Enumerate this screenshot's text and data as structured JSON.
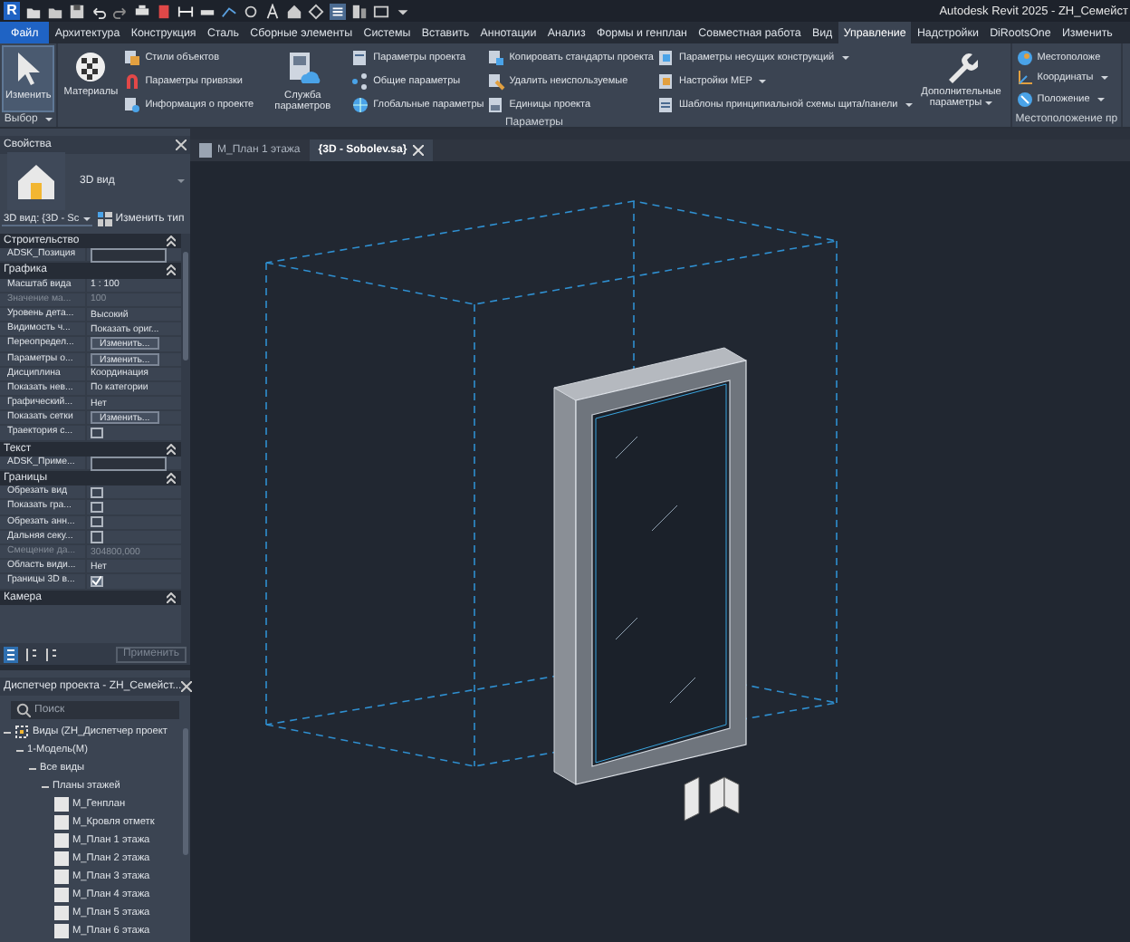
{
  "title_bar": {
    "logo": "R",
    "title": "Autodesk Revit 2025 - ZH_Семейст"
  },
  "menu_tabs": [
    {
      "label": "Файл",
      "kind": "file",
      "selected": false
    },
    {
      "label": "Архитектура",
      "kind": "tab",
      "selected": false
    },
    {
      "label": "Конструкция",
      "kind": "tab",
      "selected": false
    },
    {
      "label": "Сталь",
      "kind": "tab",
      "selected": false
    },
    {
      "label": "Сборные элементы",
      "kind": "tab",
      "selected": false
    },
    {
      "label": "Системы",
      "kind": "tab",
      "selected": false
    },
    {
      "label": "Вставить",
      "kind": "tab",
      "selected": false
    },
    {
      "label": "Аннотации",
      "kind": "tab",
      "selected": false
    },
    {
      "label": "Анализ",
      "kind": "tab",
      "selected": false
    },
    {
      "label": "Формы и генплан",
      "kind": "tab",
      "selected": false
    },
    {
      "label": "Совместная работа",
      "kind": "tab",
      "selected": false
    },
    {
      "label": "Вид",
      "kind": "tab",
      "selected": false
    },
    {
      "label": "Управление",
      "kind": "tab",
      "selected": true
    },
    {
      "label": "Надстройки",
      "kind": "tab",
      "selected": false
    },
    {
      "label": "DiRootsOne",
      "kind": "tab",
      "selected": false
    },
    {
      "label": "Изменить",
      "kind": "tab",
      "selected": false
    }
  ],
  "ribbon": {
    "panels": [
      {
        "label": "Выбор",
        "dropdown": true,
        "groups": [
          {
            "kind": "large",
            "label": "Изменить",
            "selected": true,
            "dropdown": false
          }
        ]
      },
      {
        "label": "Параметры",
        "dropdown": false,
        "groups": [
          {
            "kind": "large",
            "label": "Материалы",
            "selected": false,
            "dropdown": false
          },
          {
            "kind": "stack",
            "items": [
              {
                "label": "Стили объектов",
                "dropdown": false
              },
              {
                "label": "Параметры привязки",
                "dropdown": false
              },
              {
                "label": "Информация о проекте",
                "dropdown": false
              }
            ]
          },
          {
            "kind": "large",
            "label": "Служба параметров",
            "selected": false,
            "dropdown": false
          },
          {
            "kind": "stack",
            "items": [
              {
                "label": "Параметры проекта",
                "dropdown": false
              },
              {
                "label": "Общие параметры",
                "dropdown": false
              },
              {
                "label": "Глобальные  параметры",
                "dropdown": false
              }
            ]
          },
          {
            "kind": "stack",
            "items": [
              {
                "label": "Копировать стандарты проекта",
                "dropdown": false
              },
              {
                "label": "Удалить неиспользуемые",
                "dropdown": false
              },
              {
                "label": "Единицы проекта",
                "dropdown": false
              }
            ]
          },
          {
            "kind": "stack",
            "items": [
              {
                "label": "Параметры несущих конструкций",
                "dropdown": true
              },
              {
                "label": "Настройки MEP",
                "dropdown": true
              },
              {
                "label": "Шаблоны принципиальной схемы щита/панели",
                "dropdown": true
              }
            ]
          },
          {
            "kind": "large",
            "label": "Дополнительные параметры",
            "selected": false,
            "dropdown": true
          }
        ]
      },
      {
        "label": "Местоположение пр",
        "dropdown": false,
        "groups": [
          {
            "kind": "stack",
            "items": [
              {
                "label": "Местоположе",
                "dropdown": false
              },
              {
                "label": "Координаты",
                "dropdown": true
              },
              {
                "label": "Положение",
                "dropdown": true
              }
            ]
          }
        ]
      }
    ]
  },
  "properties": {
    "title": "Свойства",
    "type_name": "3D вид",
    "view_selector": "3D вид: {3D - Sc",
    "edit_type": "Изменить тип",
    "sections": [
      {
        "title": "Строительство",
        "rows": [
          {
            "kind": "field",
            "label": "ADSK_Позиция",
            "disabled": false
          }
        ]
      },
      {
        "title": "Графика",
        "rows": [
          {
            "kind": "text",
            "label": "Масштаб вида",
            "value": "1 : 100",
            "disabled": false
          },
          {
            "kind": "text",
            "label": "Значение ма...",
            "value": "100",
            "disabled": true
          },
          {
            "kind": "text",
            "label": "Уровень дета...",
            "value": "Высокий",
            "disabled": false
          },
          {
            "kind": "text",
            "label": "Видимость ч...",
            "value": "Показать ориг...",
            "disabled": false
          },
          {
            "kind": "button",
            "label": "Переопредел...",
            "value": "Изменить...",
            "disabled": false
          },
          {
            "kind": "button",
            "label": "Параметры о...",
            "value": "Изменить...",
            "disabled": false
          },
          {
            "kind": "text",
            "label": "Дисциплина",
            "value": "Координация",
            "disabled": false
          },
          {
            "kind": "text",
            "label": "Показать нев...",
            "value": "По категории",
            "disabled": false
          },
          {
            "kind": "text",
            "label": "Графический...",
            "value": "Нет",
            "disabled": false
          },
          {
            "kind": "button",
            "label": "Показать сетки",
            "value": "Изменить...",
            "disabled": false
          },
          {
            "kind": "checkbox",
            "label": "Траектория с...",
            "checked": false,
            "disabled": false
          }
        ]
      },
      {
        "title": "Текст",
        "rows": [
          {
            "kind": "field",
            "label": "ADSK_Приме...",
            "disabled": false
          }
        ]
      },
      {
        "title": "Границы",
        "rows": [
          {
            "kind": "checkbox",
            "label": "Обрезать вид",
            "checked": false,
            "disabled": false
          },
          {
            "kind": "checkbox",
            "label": "Показать гра...",
            "checked": false,
            "disabled": false
          },
          {
            "kind": "checkbox",
            "label": "Обрезать анн...",
            "checked": false,
            "disabled": false
          },
          {
            "kind": "checkbox",
            "label": "Дальняя секу...",
            "checked": false,
            "disabled": false
          },
          {
            "kind": "text",
            "label": "Смещение да...",
            "value": "304800,000",
            "disabled": true
          },
          {
            "kind": "text",
            "label": "Область види...",
            "value": "Нет",
            "disabled": false
          },
          {
            "kind": "checkbox",
            "label": "Границы 3D в...",
            "checked": true,
            "disabled": false
          }
        ]
      },
      {
        "title": "Камера"
      }
    ],
    "apply_button": {
      "label": "Применить",
      "disabled": true
    }
  },
  "project_browser": {
    "title": "Диспетчер проекта - ZH_Семейст...",
    "search": {
      "placeholder": "Поиск"
    },
    "tree": [
      {
        "label": "Виды (ZH_Диспетчер проект",
        "expanded": true,
        "children": [
          {
            "label": "1-Модель(M)",
            "expanded": true,
            "children": [
              {
                "label": "Все виды",
                "expanded": true,
                "children": [
                  {
                    "label": "Планы этажей",
                    "expanded": true,
                    "children": [
                      {
                        "label": "М_Генплан"
                      },
                      {
                        "label": "М_Кровля отметк"
                      },
                      {
                        "label": "М_План 1 этажа"
                      },
                      {
                        "label": "М_План 2 этажа"
                      },
                      {
                        "label": "М_План 3 этажа"
                      },
                      {
                        "label": "М_План 4 этажа"
                      },
                      {
                        "label": "М_План 5 этажа"
                      },
                      {
                        "label": "М_План 6 этажа"
                      }
                    ]
                  }
                ]
              }
            ]
          }
        ]
      }
    ]
  },
  "view_tabs": [
    {
      "label": "М_План 1 этажа",
      "kind": "plan",
      "selected": false
    },
    {
      "label": "{3D - Sobolev.sa}",
      "kind": "model",
      "selected": true
    }
  ]
}
